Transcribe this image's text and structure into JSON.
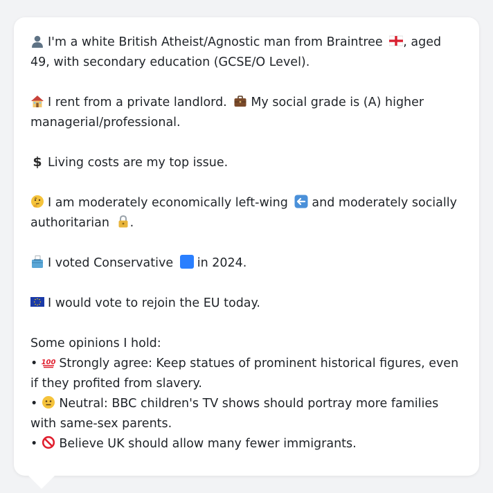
{
  "profile": {
    "identity": {
      "icon": "person-silhouette-icon",
      "text_before_flag": "I'm a white British Atheist/Agnostic man from Braintree",
      "flag_icon": "england-flag-icon",
      "text_after_flag": ", aged 49, with secondary education (GCSE/O Level)."
    },
    "housing": {
      "icon": "house-icon",
      "text1": "I rent from a private landlord.",
      "briefcase_icon": "briefcase-icon",
      "text2": "My social grade is (A) higher managerial/professional."
    },
    "top_issue": {
      "icon": "dollar-sign-icon",
      "text": "Living costs are my top issue."
    },
    "politics": {
      "icon": "thinking-face-icon",
      "text1": "I am moderately economically left-wing",
      "arrow_icon": "left-arrow-icon",
      "text2": "and moderately socially authoritarian",
      "lock_icon": "lock-icon",
      "text3": "."
    },
    "vote_2024": {
      "icon": "ballot-box-icon",
      "text1": "I voted Conservative",
      "party_icon": "blue-square-icon",
      "text2": "in 2024."
    },
    "eu": {
      "icon": "eu-flag-icon",
      "text": "I would vote to rejoin the EU today."
    },
    "opinions_heading": "Some opinions I hold:",
    "opinions": [
      {
        "bullet": "•",
        "icon": "hundred-points-icon",
        "text": "Strongly agree: Keep statues of prominent historical figures, even if they profited from slavery."
      },
      {
        "bullet": "•",
        "icon": "neutral-face-icon",
        "text": "Neutral: BBC children's TV shows should portray more families with same-sex parents."
      },
      {
        "bullet": "•",
        "icon": "prohibited-icon",
        "text": "Believe UK should allow many fewer immigrants."
      }
    ]
  },
  "colors": {
    "background": "#f2f3f5",
    "card": "#ffffff",
    "text": "#1f2328",
    "blue_square": "#2a7fff",
    "eu_blue": "#1a3aa8",
    "england_red": "#d8202f"
  }
}
